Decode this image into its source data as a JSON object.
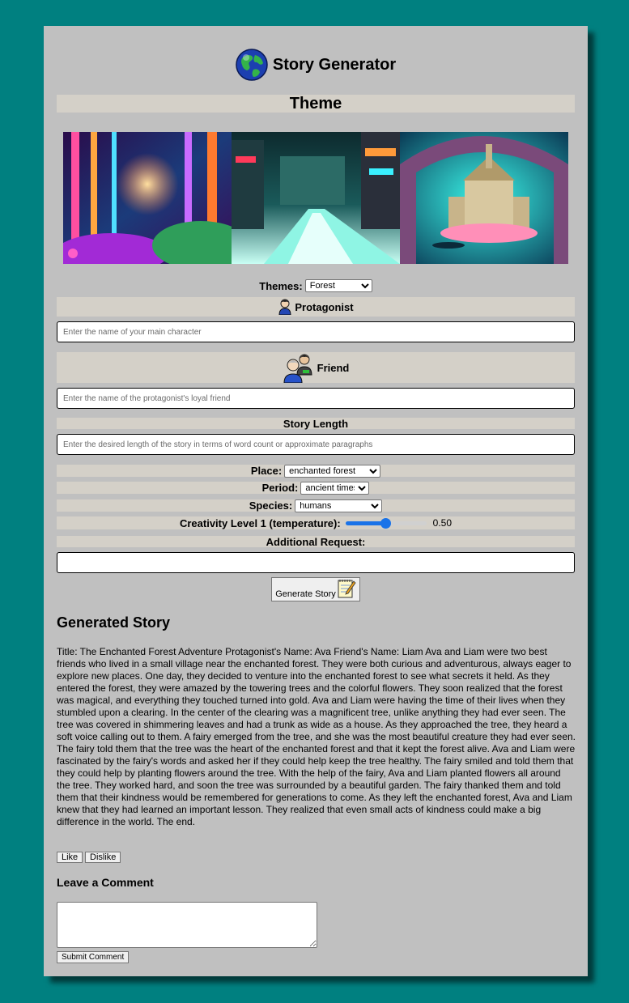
{
  "app": {
    "title": "Story Generator"
  },
  "theme_section": {
    "heading": "Theme"
  },
  "themes": {
    "label": "Themes:",
    "selected": "Forest"
  },
  "protagonist": {
    "label": "Protagonist",
    "placeholder": "Enter the name of your main character"
  },
  "friend": {
    "label": "Friend",
    "placeholder": "Enter the name of the protagonist's loyal friend"
  },
  "story_length": {
    "label": "Story Length",
    "placeholder": "Enter the desired length of the story in terms of word count or approximate paragraphs"
  },
  "place": {
    "label": "Place:",
    "selected": "enchanted forest"
  },
  "period": {
    "label": "Period:",
    "selected": "ancient times"
  },
  "species": {
    "label": "Species:",
    "selected": "humans"
  },
  "creativity": {
    "label": "Creativity Level 1 (temperature):",
    "value": "0.50",
    "fraction": 0.5
  },
  "additional": {
    "label": "Additional Request:",
    "value": ""
  },
  "generate_button": {
    "label": "Generate Story"
  },
  "generated": {
    "heading": "Generated Story",
    "text": "Title: The Enchanted Forest Adventure Protagonist's Name: Ava Friend's Name: Liam Ava and Liam were two best friends who lived in a small village near the enchanted forest. They were both curious and adventurous, always eager to explore new places. One day, they decided to venture into the enchanted forest to see what secrets it held. As they entered the forest, they were amazed by the towering trees and the colorful flowers. They soon realized that the forest was magical, and everything they touched turned into gold. Ava and Liam were having the time of their lives when they stumbled upon a clearing. In the center of the clearing was a magnificent tree, unlike anything they had ever seen. The tree was covered in shimmering leaves and had a trunk as wide as a house. As they approached the tree, they heard a soft voice calling out to them. A fairy emerged from the tree, and she was the most beautiful creature they had ever seen. The fairy told them that the tree was the heart of the enchanted forest and that it kept the forest alive. Ava and Liam were fascinated by the fairy's words and asked her if they could help keep the tree healthy. The fairy smiled and told them that they could help by planting flowers around the tree. With the help of the fairy, Ava and Liam planted flowers all around the tree. They worked hard, and soon the tree was surrounded by a beautiful garden. The fairy thanked them and told them that their kindness would be remembered for generations to come. As they left the enchanted forest, Ava and Liam knew that they had learned an important lesson. They realized that even small acts of kindness could make a big difference in the world. The end."
  },
  "feedback": {
    "like": "Like",
    "dislike": "Dislike"
  },
  "comment": {
    "heading": "Leave a Comment",
    "value": "",
    "submit": "Submit Comment"
  },
  "colors": {
    "background": "#008080",
    "panel": "#c0c0c0",
    "band": "#d4d0c8",
    "accent": "#1a73e8"
  },
  "icons": {
    "header": "globe-icon",
    "protagonist": "person-icon",
    "friend": "two-people-icon",
    "generate": "notepad-pencil-icon"
  }
}
